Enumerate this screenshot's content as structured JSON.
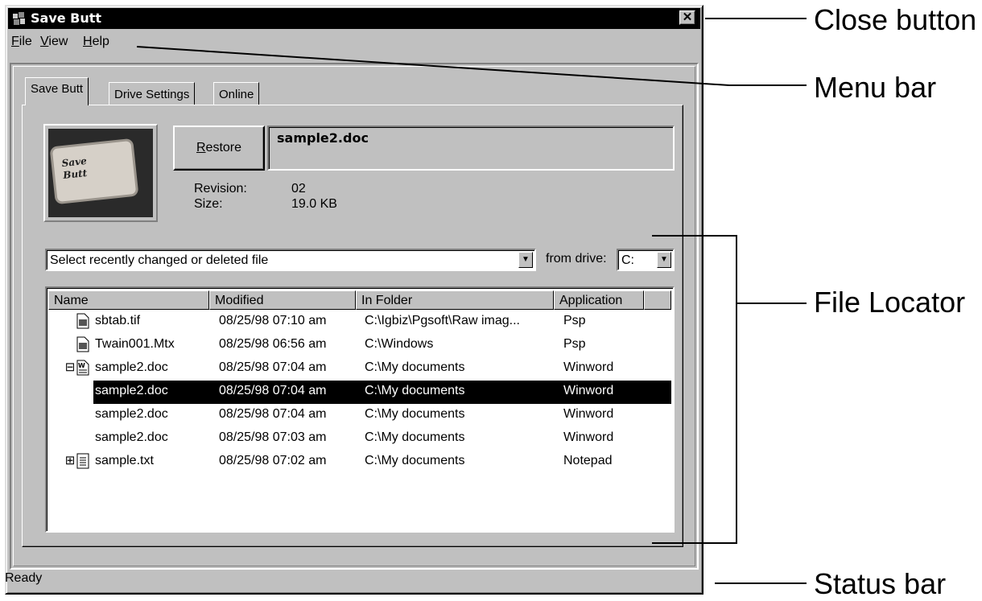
{
  "window": {
    "title": "Save Butt",
    "close_glyph": "✕",
    "app_icon": "puzzle-icon"
  },
  "menu": {
    "items": [
      {
        "underline": "F",
        "rest": "ile"
      },
      {
        "underline": "V",
        "rest": "iew"
      },
      {
        "underline": "H",
        "rest": "elp"
      }
    ]
  },
  "tabs": [
    "Save Butt",
    "Drive Settings",
    "Online"
  ],
  "logo": {
    "line1": "Save",
    "line2": "Butt"
  },
  "restore": {
    "underline": "R",
    "rest": "estore"
  },
  "selected_file": "sample2.doc",
  "revision": {
    "label": "Revision:",
    "value": "02"
  },
  "size": {
    "label": "Size:",
    "value": "19.0 KB"
  },
  "file_select": {
    "value": "Select recently changed or deleted file"
  },
  "drive": {
    "label": "from drive:",
    "value": "C:"
  },
  "list": {
    "columns": [
      "Name",
      "Modified",
      "In Folder",
      "Application"
    ],
    "rows": [
      {
        "name": "sbtab.tif",
        "modified": "08/25/98 07:10 am",
        "folder": "C:\\Igbiz\\Pgsoft\\Raw imag...",
        "app": "Psp",
        "icon": "image-file-icon",
        "expander": "",
        "selected": false
      },
      {
        "name": "Twain001.Mtx",
        "modified": "08/25/98 06:56 am",
        "folder": "C:\\Windows",
        "app": "Psp",
        "icon": "image-file-icon",
        "expander": "",
        "selected": false
      },
      {
        "name": "sample2.doc",
        "modified": "08/25/98 07:04 am",
        "folder": "C:\\My documents",
        "app": "Winword",
        "icon": "word-doc-icon",
        "expander": "⊟",
        "selected": false
      },
      {
        "name": "sample2.doc",
        "modified": "08/25/98 07:04 am",
        "folder": "C:\\My documents",
        "app": "Winword",
        "icon": "",
        "expander": "",
        "selected": true
      },
      {
        "name": "sample2.doc",
        "modified": "08/25/98 07:04 am",
        "folder": "C:\\My documents",
        "app": "Winword",
        "icon": "",
        "expander": "",
        "selected": false
      },
      {
        "name": "sample2.doc",
        "modified": "08/25/98 07:03 am",
        "folder": "C:\\My documents",
        "app": "Winword",
        "icon": "",
        "expander": "",
        "selected": false
      },
      {
        "name": "sample.txt",
        "modified": "08/25/98 07:02 am",
        "folder": "C:\\My documents",
        "app": "Notepad",
        "icon": "text-file-icon",
        "expander": "⊞",
        "selected": false
      }
    ]
  },
  "status": {
    "text": "Ready"
  },
  "callouts": {
    "close": "Close button",
    "menu": "Menu bar",
    "locator": "File Locator",
    "status": "Status bar"
  }
}
